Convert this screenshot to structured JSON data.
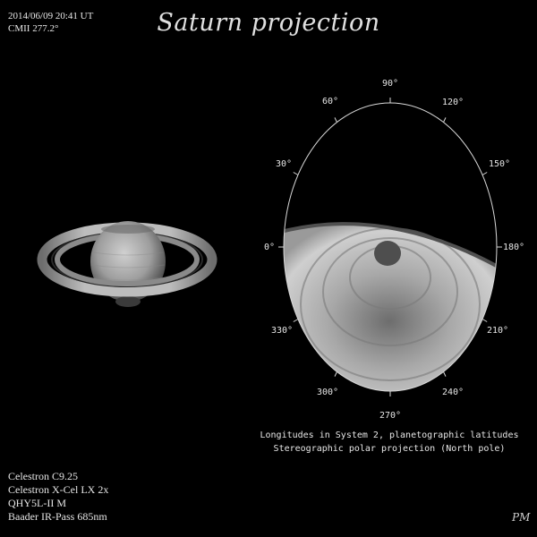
{
  "header": {
    "datetime": "2014/06/09 20:41 UT",
    "cm": "CMII 277.2°",
    "title": "Saturn projection"
  },
  "projection": {
    "longitude_labels": [
      "90°",
      "120°",
      "150°",
      "180°",
      "210°",
      "240°",
      "270°",
      "300°",
      "330°",
      "0°",
      "30°",
      "60°"
    ],
    "caption_line1": "Longitudes in System 2, planetographic latitudes",
    "caption_line2": "Stereographic polar projection (North pole)"
  },
  "equipment": {
    "line1": "Celestron C9.25",
    "line2": "Celestron X-Cel LX 2x",
    "line3": "QHY5L-II M",
    "line4": "Baader IR-Pass 685nm"
  },
  "signature": "PM"
}
